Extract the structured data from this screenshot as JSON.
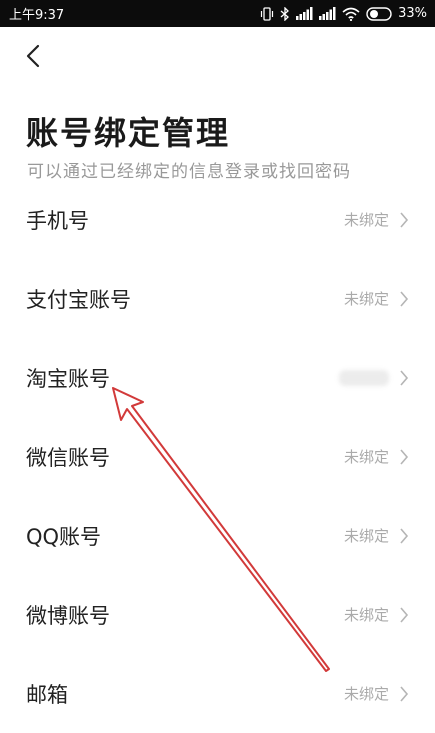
{
  "status_bar": {
    "time": "上午9:37",
    "battery": "33%"
  },
  "page": {
    "title": "账号绑定管理",
    "subtitle": "可以通过已经绑定的信息登录或找回密码"
  },
  "accounts": [
    {
      "label": "手机号",
      "status": "未绑定"
    },
    {
      "label": "支付宝账号",
      "status": "未绑定"
    },
    {
      "label": "淘宝账号",
      "status": ""
    },
    {
      "label": "微信账号",
      "status": "未绑定"
    },
    {
      "label": "QQ账号",
      "status": "未绑定"
    },
    {
      "label": "微博账号",
      "status": "未绑定"
    },
    {
      "label": "邮箱",
      "status": "未绑定"
    }
  ],
  "colors": {
    "status_bar_bg": "#0c0c0c",
    "annotation_arrow": "#d23a3a"
  }
}
